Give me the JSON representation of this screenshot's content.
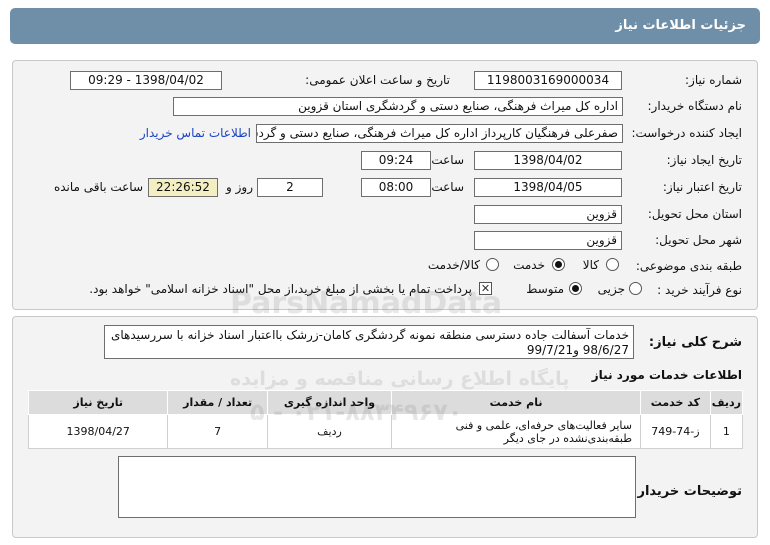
{
  "title": "جزئیات اطلاعات نیاز",
  "fields": {
    "need_number_label": "شماره نیاز:",
    "need_number": "1198003169000034",
    "announce_label": "تاریخ و ساعت اعلان عمومی:",
    "announce_value": "1398/04/02 - 09:29",
    "buyer_org_label": "نام دستگاه خریدار:",
    "buyer_org": "اداره کل میراث فرهنگی، صنایع دستی و گردشگری استان قزوین",
    "requester_label": "ایجاد کننده درخواست:",
    "requester": "صفرعلی فرهنگیان کارپرداز اداره کل میراث فرهنگی، صنایع دستی و گردشگری ا",
    "contact_link": "اطلاعات تماس خریدار",
    "created_label": "تاریخ ایجاد نیاز:",
    "created_date": "1398/04/02",
    "time_label": "ساعت",
    "created_time": "09:24",
    "validity_label": "تاریخ اعتبار نیاز:",
    "validity_date": "1398/04/05",
    "validity_time": "08:00",
    "days": "2",
    "day_and_label": "روز و",
    "remaining": "22:26:52",
    "remaining_label": "ساعت باقی مانده",
    "province_label": "استان محل تحویل:",
    "province": "قزوین",
    "city_label": "شهر محل تحویل:",
    "city": "قزوین",
    "category_label": "طبقه بندی موضوعی:",
    "category_options": [
      "کالا",
      "خدمت",
      "کالا/خدمت"
    ],
    "category_selected": "خدمت",
    "process_label": "نوع فرآیند خرید :",
    "process_options": [
      "جزیی",
      "متوسط"
    ],
    "process_selected": "متوسط",
    "payment_note": "پرداخت تمام یا بخشی از مبلغ خرید،از محل \"اسناد خزانه اسلامی\" خواهد بود."
  },
  "description_label": "شرح کلی نیاز:",
  "description": "خدمات آسفالت جاده دسترسی منطقه نمونه گردشگری کامان-زرشک بااعتبار اسناد خزانه با سررسیدهای 98/6/27 و99/7/21",
  "services_title": "اطلاعات خدمات مورد نیاز",
  "table": {
    "headers": [
      "ردیف",
      "کد خدمت",
      "نام خدمت",
      "واحد اندازه گیری",
      "تعداد / مقدار",
      "تاریخ نیاز"
    ],
    "rows": [
      [
        "1",
        "ز-74-749",
        "سایر فعالیت‌های حرفه‌ای، علمی و فنی طبقه‌بندی‌نشده در جای دیگر",
        "ردیف",
        "7",
        "1398/04/27"
      ]
    ]
  },
  "buyer_notes_label": "توضیحات خریدار:",
  "buyer_notes": "",
  "watermark": {
    "brand": "ParsNamadData",
    "tagline": "پایگاه اطلاع رسانی مناقصه و مزایده",
    "phone": "۰۲۱-۸۸۳۴۹۶۷۰ - ۵"
  }
}
